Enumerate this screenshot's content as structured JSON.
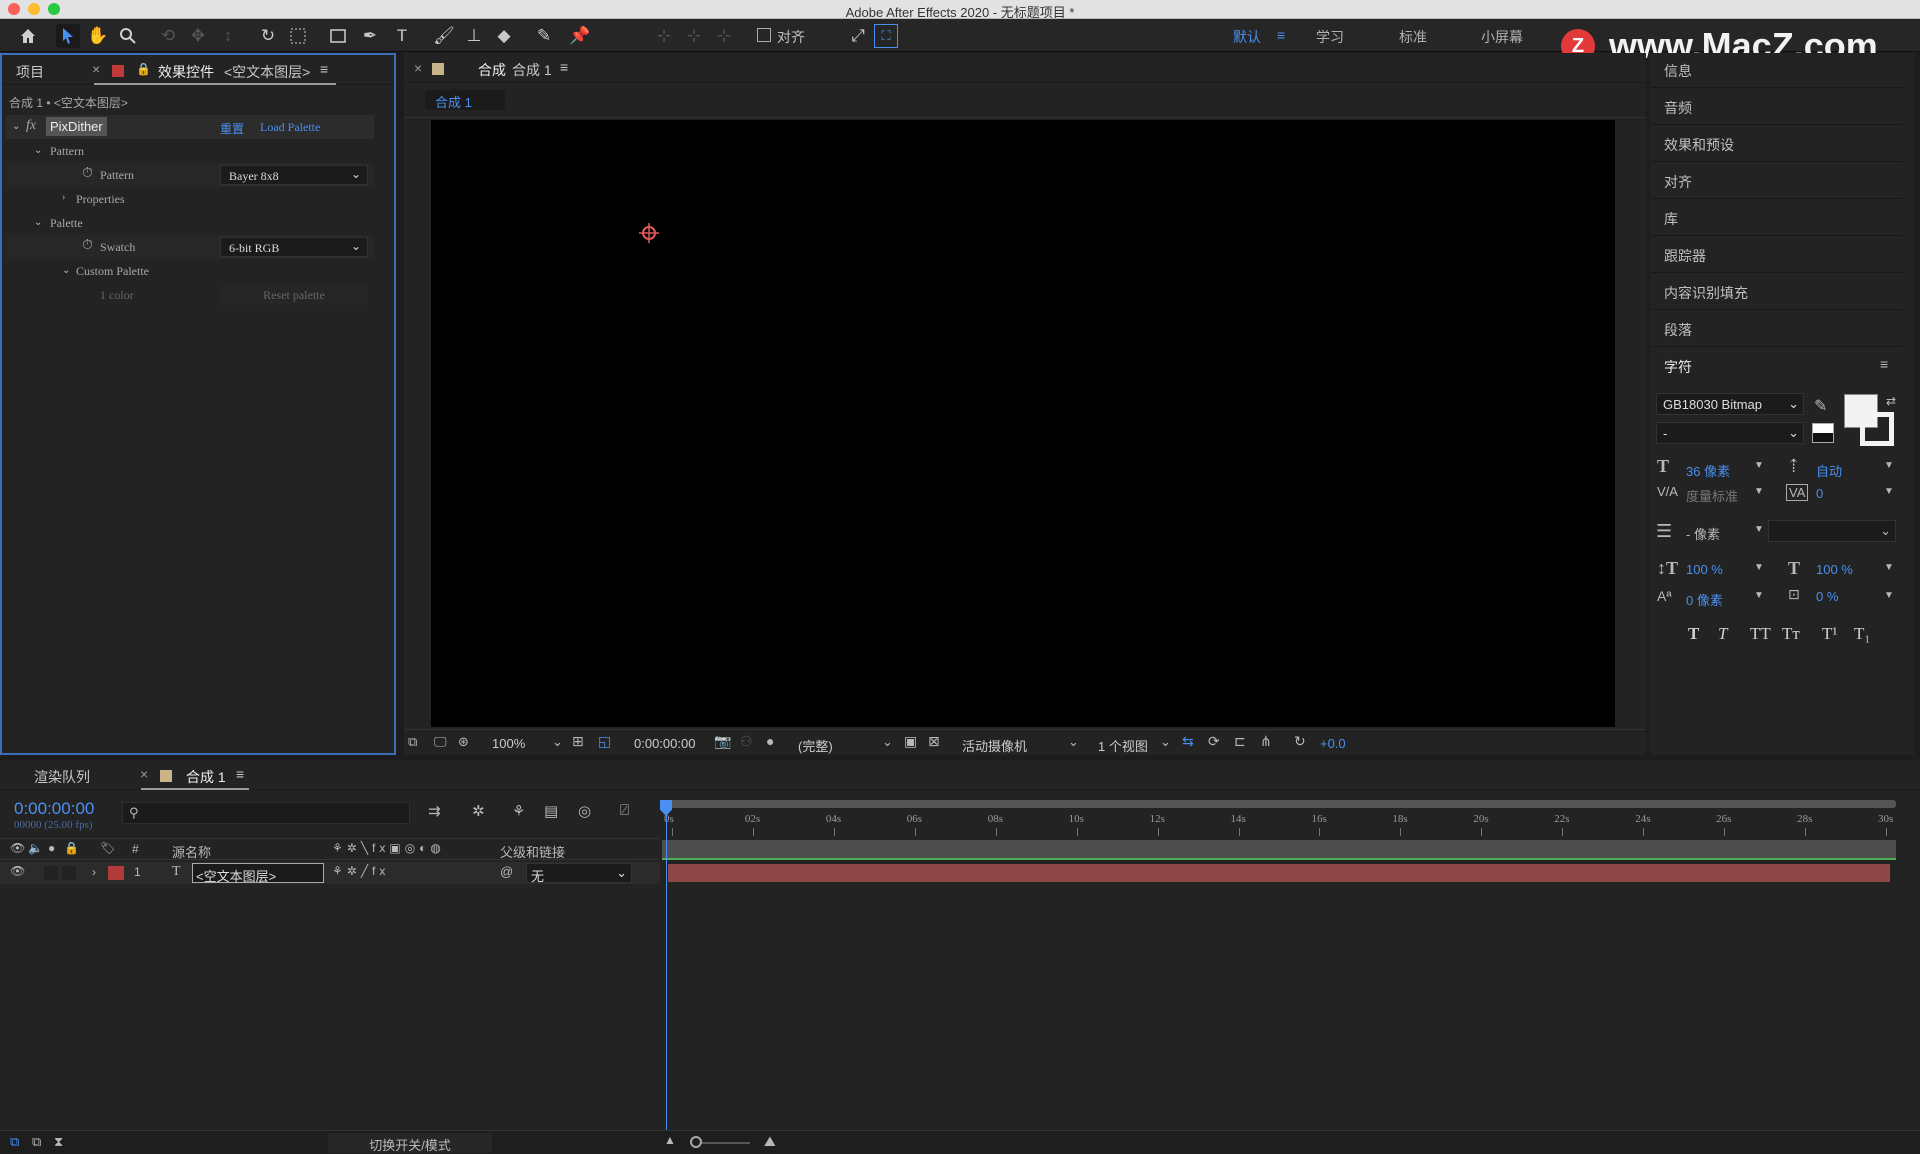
{
  "app_title": "Adobe After Effects 2020 - 无标题项目 *",
  "toolbar": {
    "align_label": "对齐",
    "workspaces": [
      "默认",
      "学习",
      "标准",
      "小屏幕"
    ],
    "watermark": "www.MacZ.com"
  },
  "left_panel": {
    "tab_project": "项目",
    "tab_effects_prefix": "效果控件",
    "tab_effects_layer": "<空文本图层>",
    "breadcrumb": "合成 1 • <空文本图层>",
    "effect_name": "PixDither",
    "reset_label": "重置",
    "load_palette_label": "Load Palette",
    "rows": {
      "pattern_group": "Pattern",
      "pattern_label": "Pattern",
      "pattern_value": "Bayer 8x8",
      "properties": "Properties",
      "palette_group": "Palette",
      "swatch_label": "Swatch",
      "swatch_value": "6-bit RGB",
      "custom_palette": "Custom Palette",
      "color_count": "1 color",
      "reset_palette": "Reset palette"
    }
  },
  "comp_panel": {
    "tab_label": "合成",
    "tab_comp_name": "合成 1",
    "subtab": "合成 1",
    "zoom": "100%",
    "timecode": "0:00:00:00",
    "quality": "(完整)",
    "camera": "活动摄像机",
    "views": "1 个视图",
    "exposure": "+0.0"
  },
  "right_panel": {
    "items": [
      "信息",
      "音频",
      "效果和预设",
      "对齐",
      "库",
      "跟踪器",
      "内容识别填充",
      "段落"
    ],
    "character_title": "字符",
    "font_family": "GB18030 Bitmap",
    "font_style": "-",
    "font_size": "36 像素",
    "leading": "自动",
    "kerning": "度量标准",
    "tracking": "0",
    "stroke_width": "- 像素",
    "vertical_scale": "100 %",
    "horizontal_scale": "100 %",
    "baseline_shift": "0 像素",
    "tsume": "0 %",
    "style_buttons": [
      "T",
      "T",
      "TT",
      "Tт",
      "T¹",
      "T₁"
    ]
  },
  "timeline": {
    "tab_render": "渲染队列",
    "tab_comp": "合成 1",
    "timecode": "0:00:00:00",
    "frame_info": "00000 (25.00 fps)",
    "col_num": "#",
    "col_source": "源名称",
    "col_parent": "父级和链接",
    "layer_index": "1",
    "layer_name": "<空文本图层>",
    "layer_parent": "无",
    "ruler_ticks": [
      "0s",
      "02s",
      "04s",
      "06s",
      "08s",
      "10s",
      "12s",
      "14s",
      "16s",
      "18s",
      "20s",
      "22s",
      "24s",
      "26s",
      "28s",
      "30s"
    ],
    "toggle_label": "切换开关/模式",
    "layer_color": "#b13a3a",
    "bar_color": "#8e4848"
  }
}
